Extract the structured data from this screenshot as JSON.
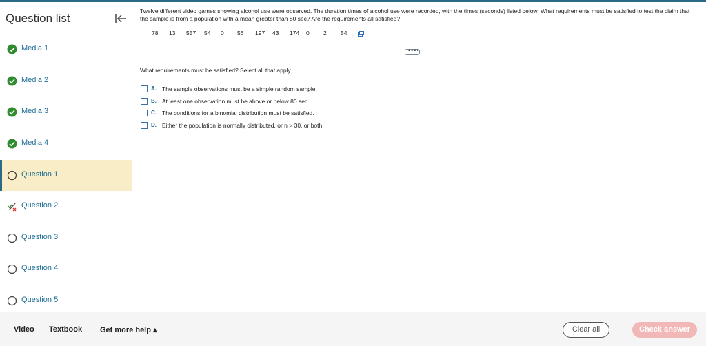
{
  "sidebar": {
    "title": "Question list",
    "items": [
      {
        "label": "Media 1",
        "status": "complete"
      },
      {
        "label": "Media 2",
        "status": "complete"
      },
      {
        "label": "Media 3",
        "status": "complete"
      },
      {
        "label": "Media 4",
        "status": "complete"
      },
      {
        "label": "Question 1",
        "status": "current"
      },
      {
        "label": "Question 2",
        "status": "partial"
      },
      {
        "label": "Question 3",
        "status": "not-started"
      },
      {
        "label": "Question 4",
        "status": "not-started"
      },
      {
        "label": "Question 5",
        "status": "not-started"
      }
    ]
  },
  "question": {
    "text": "Twelve different video games showing alcohol use were observed. The duration times of alcohol use were recorded, with the times (seconds) listed below. What requirements must be satisfied to test the claim that the sample is from a population with a mean greater than 80 sec? Are the requirements all satisfied?",
    "data_values": [
      "78",
      "13",
      "557",
      "54",
      "0",
      "56",
      "197",
      "43",
      "174",
      "0",
      "2",
      "54"
    ],
    "more_label": "••••",
    "prompt": "What requirements must be satisfied? Select all that apply.",
    "options": [
      {
        "letter": "A.",
        "text": "The sample observations must be a simple random sample."
      },
      {
        "letter": "B.",
        "text": "At least one observation must be above or below 80 sec."
      },
      {
        "letter": "C.",
        "text": "The conditions for a binomial distribution must be satisfied."
      },
      {
        "letter": "D.",
        "text": "Either the population is normally distributed, or n > 30, or both."
      }
    ]
  },
  "footer": {
    "video": "Video",
    "textbook": "Textbook",
    "help": "Get more help ▴",
    "clear": "Clear all",
    "check": "Check answer"
  },
  "colors": {
    "accent": "#2a6a86",
    "link": "#1e6d96",
    "complete": "#2e8b2e",
    "current_bg": "#f8edc6",
    "check_button": "#f2b8b8"
  }
}
